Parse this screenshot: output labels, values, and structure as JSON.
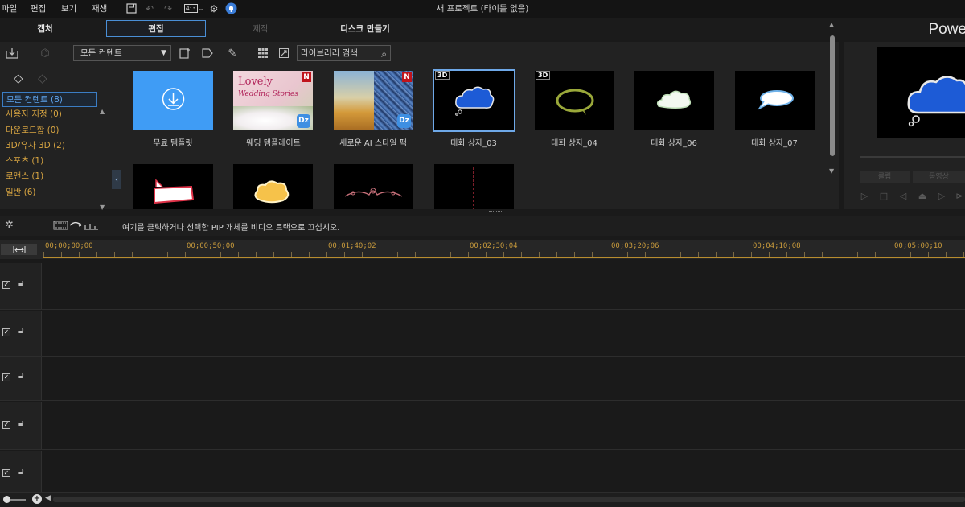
{
  "menu": {
    "items": [
      "파일",
      "편집",
      "보기",
      "재생"
    ],
    "aspect_ratio": "4:3",
    "window_title": "새 프로젝트 (타이틀 없음)"
  },
  "modes": {
    "tabs": [
      {
        "label": "캡처",
        "state": "normal"
      },
      {
        "label": "편집",
        "state": "active"
      },
      {
        "label": "제작",
        "state": "disabled"
      },
      {
        "label": "디스크 만들기",
        "state": "normal"
      }
    ],
    "brand": "Powe"
  },
  "library": {
    "filter_value": "모든 컨텐트",
    "search_placeholder": "라이브러리 검색",
    "categories": [
      {
        "label": "모든 컨텐트 (8)",
        "active": true
      },
      {
        "label": "사용자 지정 (0)",
        "active": false
      },
      {
        "label": "다운로드함 (0)",
        "active": false
      },
      {
        "label": "3D/유사 3D (2)",
        "active": false
      },
      {
        "label": "스포츠 (1)",
        "active": false
      },
      {
        "label": "로맨스 (1)",
        "active": false
      },
      {
        "label": "일반 (6)",
        "active": false
      }
    ],
    "items": [
      {
        "label": "무료 템플릿",
        "badge3d": false,
        "badgeN": false,
        "badgeDz": false
      },
      {
        "label": "웨딩 템플레이트",
        "thumb_text_1": "Lovely",
        "thumb_text_2": "Wedding Stories",
        "badge3d": false,
        "badgeN": true,
        "badgeDz": true
      },
      {
        "label": "새로운 AI 스타일 팩",
        "badge3d": false,
        "badgeN": true,
        "badgeDz": true
      },
      {
        "label": "대화 상자_03",
        "badge3d": true,
        "selected": true
      },
      {
        "label": "대화 상자_04",
        "badge3d": true
      },
      {
        "label": "대화 상자_06",
        "badge3d": false
      },
      {
        "label": "대화 상자_07",
        "badge3d": false
      }
    ],
    "badge_3d_text": "3D",
    "badge_n_text": "N",
    "badge_dz_text": "Dz"
  },
  "preview": {
    "buttons": [
      "클립",
      "동영상"
    ]
  },
  "timeline": {
    "hint": "여기를 클릭하거나 선택한 PIP 개체를 비디오 트랙으로 끄십시오.",
    "timecodes": [
      "00;00;00;00",
      "00;00;50;00",
      "00;01;40;02",
      "00;02;30;04",
      "00;03;20;06",
      "00;04;10;08",
      "00;05;00;10"
    ],
    "track_count": 5
  },
  "colors": {
    "accent_blue": "#4a8fd6",
    "category_orange": "#d9a642",
    "ruler_gold": "#b88d2e"
  }
}
